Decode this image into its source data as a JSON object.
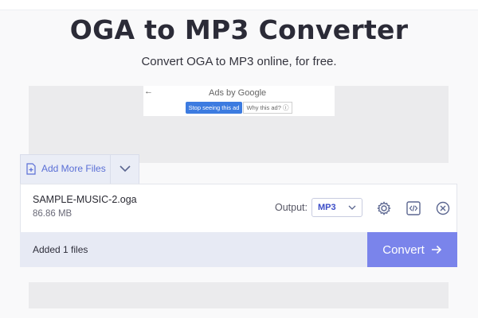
{
  "page": {
    "title": "OGA to MP3 Converter",
    "subtitle": "Convert OGA to MP3 online, for free."
  },
  "ad": {
    "ads_by": "Ads by Google",
    "stop_label": "Stop seeing this ad",
    "why_label": "Why this ad? ⓘ",
    "back_icon": "back-arrow-icon"
  },
  "uploader": {
    "add_more_label": "Add More Files",
    "add_icon": "file-add-icon",
    "caret_icon": "chevron-down-icon"
  },
  "file": {
    "name": "SAMPLE-MUSIC-2.oga",
    "size": "86.86 MB",
    "output_label": "Output:",
    "output_value": "MP3",
    "icons": [
      "gear-icon",
      "code-icon",
      "close-icon"
    ]
  },
  "footer": {
    "added_text": "Added 1 files",
    "convert_label": "Convert"
  },
  "colors": {
    "accent": "#7a84eb",
    "link": "#5a6fd6",
    "ad_button": "#3c7be0"
  }
}
